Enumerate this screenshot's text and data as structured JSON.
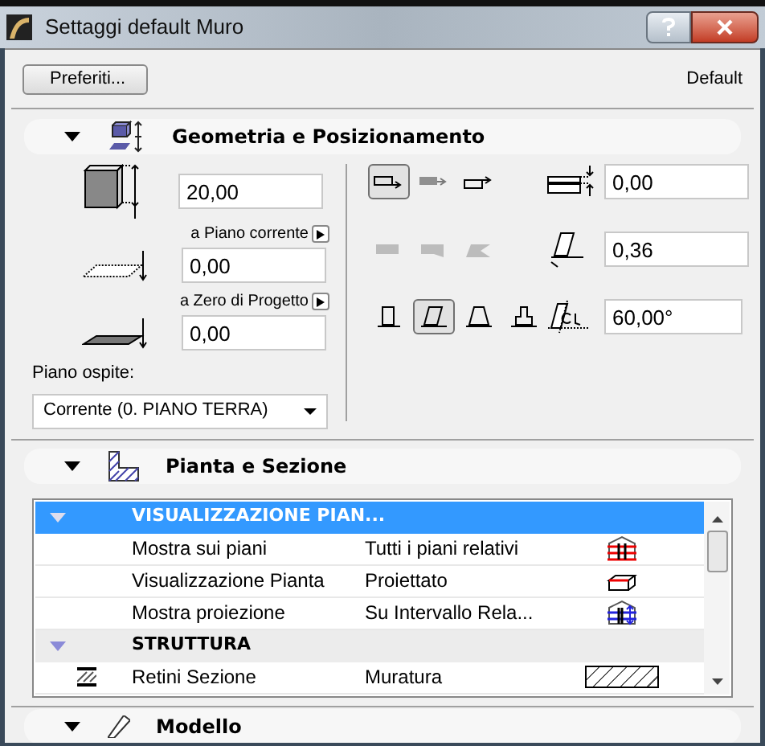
{
  "window": {
    "title": "Settaggi default Muro"
  },
  "toolbar": {
    "favorites_button": "Preferiti...",
    "preset": "Default"
  },
  "geometry": {
    "title": "Geometria e Posizionamento",
    "expanded": true,
    "height": {
      "value": "20,00"
    },
    "base_reference": {
      "label": "a Piano corrente"
    },
    "base_offset": {
      "value": "0,00"
    },
    "project_zero": {
      "label": "a Zero di Progetto"
    },
    "elevation": {
      "value": "0,00"
    },
    "home_story": {
      "label": "Piano ospite:",
      "value": "Corrente (0. PIANO TERRA)"
    },
    "reference_line_buttons": [
      {
        "selected": true,
        "disabled": false
      },
      {
        "selected": false,
        "disabled": false
      },
      {
        "selected": false,
        "disabled": false
      }
    ],
    "offset": {
      "value": "0,00"
    },
    "end_buttons": [
      {
        "selected": false,
        "disabled": true
      },
      {
        "selected": false,
        "disabled": true
      },
      {
        "selected": false,
        "disabled": true
      }
    ],
    "thickness": {
      "value": "0,36"
    },
    "shape_buttons": [
      {
        "selected": false,
        "disabled": false
      },
      {
        "selected": true,
        "disabled": false
      },
      {
        "selected": false,
        "disabled": false
      },
      {
        "selected": false,
        "disabled": false
      }
    ],
    "angle": {
      "value": "60,00°"
    }
  },
  "plan_section": {
    "title": "Pianta e Sezione",
    "expanded": true,
    "rows": [
      {
        "kind": "group",
        "name": "VISUALIZZAZIONE PIAN...",
        "expanded": true,
        "selected": true
      },
      {
        "kind": "item",
        "name": "Mostra sui piani",
        "value": "Tutti i piani relativi",
        "selected": false
      },
      {
        "kind": "item",
        "name": "Visualizzazione Pianta",
        "value": "Proiettato",
        "selected": false
      },
      {
        "kind": "item",
        "name": "Mostra proiezione",
        "value": "Su Intervallo Rela...",
        "selected": false
      },
      {
        "kind": "group",
        "name": "STRUTTURA",
        "expanded": true,
        "selected": false
      },
      {
        "kind": "item",
        "name": "Retini Sezione",
        "value": "Muratura",
        "selected": false
      }
    ]
  },
  "model": {
    "title": "Modello",
    "expanded": true
  }
}
